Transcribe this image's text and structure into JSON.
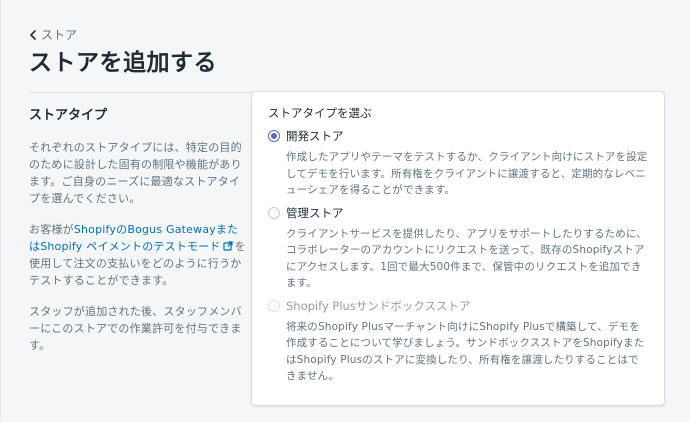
{
  "breadcrumb": {
    "label": "ストア"
  },
  "page": {
    "title": "ストアを追加する"
  },
  "aside": {
    "title": "ストアタイプ",
    "paragraph1": "それぞれのストアタイプには、特定の目的のために設計した固有の制限や機能があります。ご自身のニーズに最適なストアタイプを選んでください。",
    "paragraph2_prefix": "お客様が",
    "paragraph2_link": "ShopifyのBogus GatewayまたはShopify ペイメントのテストモード",
    "paragraph2_suffix": "を使用して注文の支払いをどのように行うかテストすることができます。",
    "paragraph3": "スタッフが追加された後、スタッフメンバーにこのストアでの作業許可を付与できます。"
  },
  "store_type": {
    "label": "ストアタイプを選ぶ",
    "options": [
      {
        "title": "開発ストア",
        "description": "作成したアプリやテーマをテストするか、クライアント向けにストアを設定してデモを行います。所有権をクライアントに譲渡すると、定期的なレベニューシェアを得ることができます。",
        "state": "checked"
      },
      {
        "title": "管理ストア",
        "description": "クライアントサービスを提供したり、アプリをサポートしたりするために、コラボレーターのアカウントにリクエストを送って、既存のShopifyストアにアクセスします。1回で最大500件まで、保管中のリクエストを追加できます。",
        "state": "unchecked"
      },
      {
        "title": "Shopify Plusサンドボックスストア",
        "description": "将来のShopify Plusマーチャント向けにShopify Plusで構築して、デモを作成することについて学びましょう。サンドボックスストアをShopifyまたはShopify Plusのストアに変換したり、所有権を譲渡したりすることはできません。",
        "state": "disabled"
      }
    ]
  },
  "icons": {
    "back": "chevron-left-icon",
    "external": "external-link-icon"
  },
  "colors": {
    "accent": "#5c6ac4",
    "link": "#006fbb",
    "text": "#212b36",
    "subdued": "#637381",
    "background": "#f4f6f8"
  }
}
